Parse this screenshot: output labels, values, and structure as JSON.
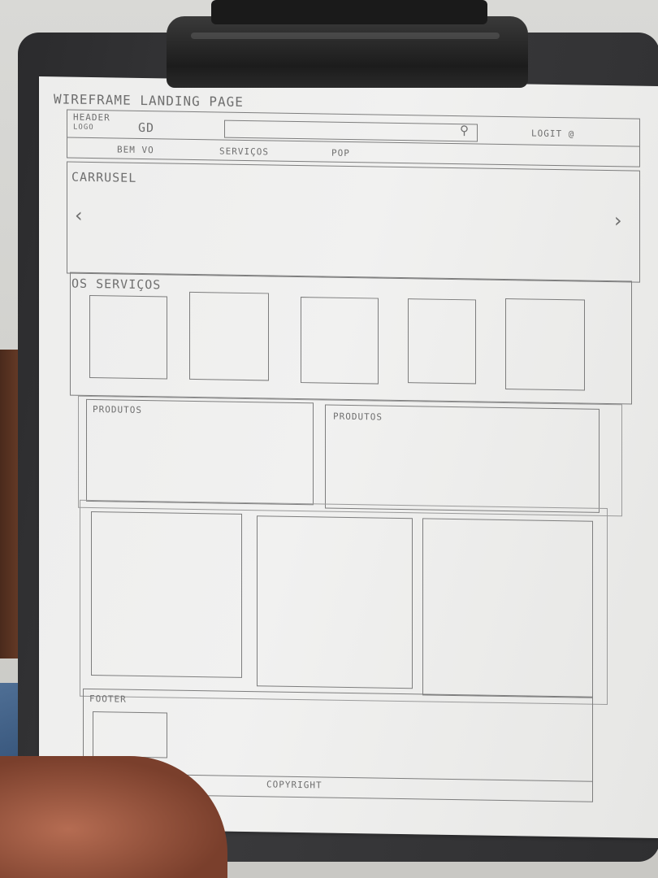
{
  "sketch": {
    "title": "WIREFRAME LANDING PAGE",
    "header": {
      "label": "HEADER",
      "logo": "LOGO",
      "brand_mark": "GD",
      "search_icon": "magnifier-icon",
      "account": "LOGIT @",
      "nav_items": [
        "BEM VO",
        "SERVIÇOS",
        "POP"
      ]
    },
    "carousel": {
      "label": "CARRUSEL",
      "prev": "‹",
      "next": "›"
    },
    "services": {
      "label": "OS SERVIÇOS",
      "box_count": 5
    },
    "products": {
      "left_label": "PRODUTOS",
      "right_label": "PRODUTOS"
    },
    "footer": {
      "label": "FOOTER",
      "copyright": "COPYRIGHT"
    }
  }
}
